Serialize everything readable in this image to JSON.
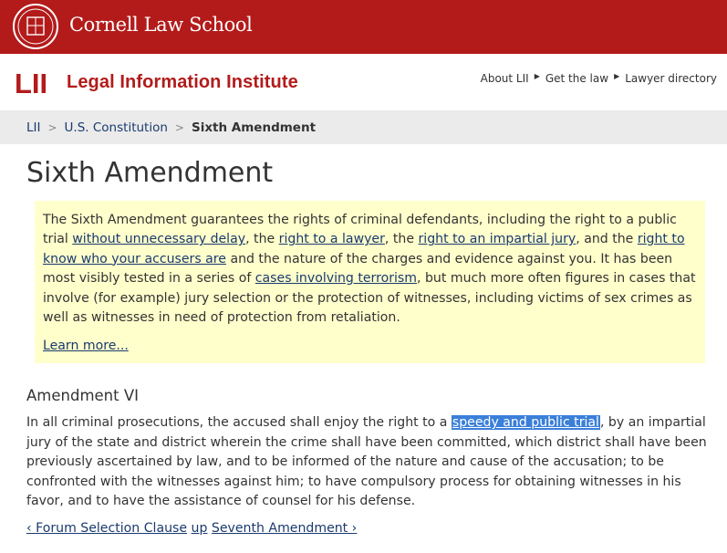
{
  "brand": {
    "cornell_name": "Cornell Law School",
    "lii_abbrev": "LII",
    "lii_title": "Legal Information Institute",
    "accent": "#b31b1b"
  },
  "top_nav": [
    {
      "label": "About LII"
    },
    {
      "label": "Get the law"
    },
    {
      "label": "Lawyer directory"
    }
  ],
  "breadcrumb": {
    "items": [
      "LII",
      "U.S. Constitution"
    ],
    "current": "Sixth Amendment"
  },
  "page": {
    "title": "Sixth Amendment"
  },
  "summary": {
    "s1": "The Sixth Amendment guarantees the rights of criminal defendants, including the right to a public trial",
    "l1": "without unnecessary delay",
    "s2": ", the",
    "l2": "right to a lawyer",
    "s3": ", the",
    "l3": "right to an impartial jury",
    "s4": ", and the",
    "l4": "right to know who your accusers are",
    "s5": "and the nature of the charges and evidence against you. It has been most visibly tested in a series of",
    "l5": "cases involving terrorism",
    "s6": ", but much more often figures in cases that involve (for example) jury selection or the protection of witnesses, including victims of sex crimes as well as witnesses in need of protection from retaliation.",
    "learn_more": "Learn more..."
  },
  "amendment": {
    "heading": "Amendment VI",
    "t1": "In all criminal prosecutions, the accused shall enjoy the right to a",
    "link": "speedy and public trial",
    "t2": ", by an impartial jury of the state and district wherein the crime shall have been committed, which district shall have been previously ascertained by law, and to be informed of the nature and cause of the accusation; to be confronted with the witnesses against him; to have compulsory process for obtaining witnesses in his favor, and to have the assistance of counsel for his defense."
  },
  "pager": {
    "prev": "‹ Forum Selection Clause",
    "up": "up",
    "next": "Seventh Amendment ›"
  }
}
